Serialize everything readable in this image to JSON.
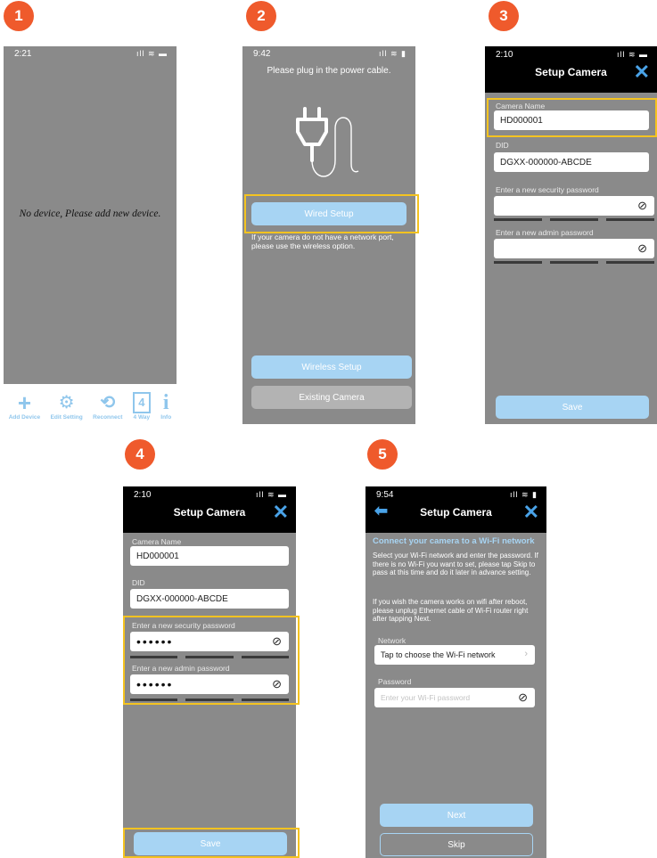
{
  "steps": [
    "1",
    "2",
    "3",
    "4",
    "5"
  ],
  "screen1": {
    "time": "2:21",
    "status_icons": "ıll ≋ ▬",
    "empty_message": "No device, Please add new device.",
    "toolbar": [
      {
        "icon": "plus-icon",
        "glyph": "+",
        "label": "Add Device"
      },
      {
        "icon": "gear-icon",
        "glyph": "⚙",
        "label": "Edit Setting"
      },
      {
        "icon": "refresh-icon",
        "glyph": "⟲",
        "label": "Reconnect"
      },
      {
        "icon": "four-way-icon",
        "glyph": "4",
        "label": "4 Way"
      },
      {
        "icon": "info-icon",
        "glyph": "i",
        "label": "Info"
      }
    ]
  },
  "screen2": {
    "time": "9:42",
    "status_icons": "ıll ≋ ▮",
    "heading": "Please plug in the power cable.",
    "wired_button": "Wired Setup",
    "hint": "If your camera do not have a network port, please use the wireless option.",
    "wireless_button": "Wireless Setup",
    "existing_button": "Existing Camera"
  },
  "screen3": {
    "time": "2:10",
    "status_icons": "ıll ≋ ▬",
    "title": "Setup Camera",
    "camera_name_label": "Camera Name",
    "camera_name_value": "HD000001",
    "did_label": "DID",
    "did_value": "DGXX-000000-ABCDE",
    "security_label": "Enter a new security password",
    "admin_label": "Enter a new admin password",
    "save_button": "Save"
  },
  "screen4": {
    "time": "2:10",
    "status_icons": "ıll ≋ ▬",
    "title": "Setup Camera",
    "camera_name_label": "Camera Name",
    "camera_name_value": "HD000001",
    "did_label": "DID",
    "did_value": "DGXX-000000-ABCDE",
    "security_label": "Enter a new security password",
    "security_value": "••••••",
    "admin_label": "Enter a new admin password",
    "admin_value": "••••••",
    "save_button": "Save"
  },
  "screen5": {
    "time": "9:54",
    "status_icons": "ıll ≋ ▮",
    "title": "Setup Camera",
    "heading": "Connect your camera to a Wi-Fi network",
    "para1": "Select your Wi-Fi network and enter the password. If there is no Wi-Fi you want to set, please tap Skip to pass at this time and do it later in advance setting.",
    "para2": "If you wish the camera works on wifi after reboot, please unplug Ethernet cable of Wi-Fi router right after tapping Next.",
    "network_label": "Network",
    "network_value": "Tap to choose the Wi-Fi network",
    "password_label": "Password",
    "password_placeholder": "Enter your Wi-Fi password",
    "next_button": "Next",
    "skip_button": "Skip"
  },
  "colors": {
    "badge": "#ef5a2c",
    "highlight": "#f4c320",
    "accent": "#a7d4f3",
    "screen_bg": "#8a8a8a"
  }
}
